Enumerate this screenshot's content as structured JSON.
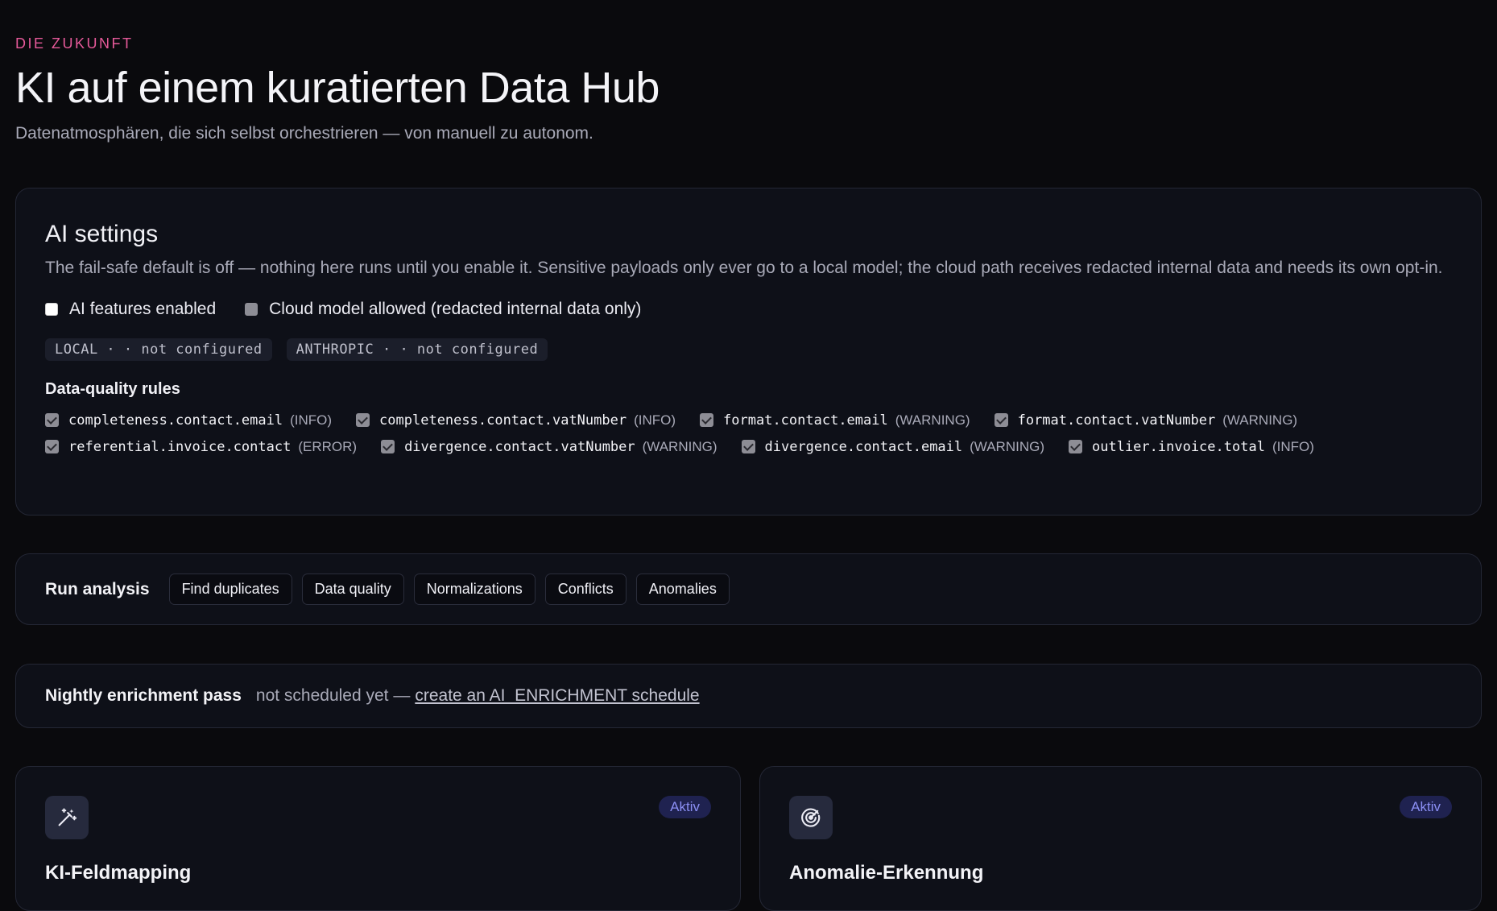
{
  "header": {
    "eyebrow": "DIE ZUKUNFT",
    "title": "KI auf einem kuratierten Data Hub",
    "subtitle": "Datenatmosphären, die sich selbst orchestrieren — von manuell zu autonom."
  },
  "settings": {
    "title": "AI settings",
    "description": "The fail-safe default is off — nothing here runs until you enable it. Sensitive payloads only ever go to a local model; the cloud path receives redacted internal data and needs its own opt-in.",
    "toggles": [
      {
        "label": "AI features enabled",
        "checked": false
      },
      {
        "label": "Cloud model allowed (redacted internal data only)",
        "checked": false
      }
    ],
    "providers": [
      "LOCAL · · not configured",
      "ANTHROPIC · · not configured"
    ],
    "rules_title": "Data-quality rules",
    "rules": [
      {
        "name": "completeness.contact.email",
        "severity": "(INFO)"
      },
      {
        "name": "completeness.contact.vatNumber",
        "severity": "(INFO)"
      },
      {
        "name": "format.contact.email",
        "severity": "(WARNING)"
      },
      {
        "name": "format.contact.vatNumber",
        "severity": "(WARNING)"
      },
      {
        "name": "referential.invoice.contact",
        "severity": "(ERROR)"
      },
      {
        "name": "divergence.contact.vatNumber",
        "severity": "(WARNING)"
      },
      {
        "name": "divergence.contact.email",
        "severity": "(WARNING)"
      },
      {
        "name": "outlier.invoice.total",
        "severity": "(INFO)"
      }
    ]
  },
  "run": {
    "label": "Run analysis",
    "buttons": [
      "Find duplicates",
      "Data quality",
      "Normalizations",
      "Conflicts",
      "Anomalies"
    ]
  },
  "nightly": {
    "label": "Nightly enrichment pass",
    "status": "not scheduled yet —",
    "link": "create an AI_ENRICHMENT schedule"
  },
  "features": [
    {
      "icon": "magic-wand-icon",
      "badge": "Aktiv",
      "title": "KI-Feldmapping"
    },
    {
      "icon": "radar-icon",
      "badge": "Aktiv",
      "title": "Anomalie-Erkennung"
    }
  ],
  "colors": {
    "background": "#0a0a0d",
    "card": "#0e1018",
    "accent_eyebrow": "#e75a9a",
    "badge_text": "#8b8ff4",
    "badge_bg": "#1f2250"
  }
}
